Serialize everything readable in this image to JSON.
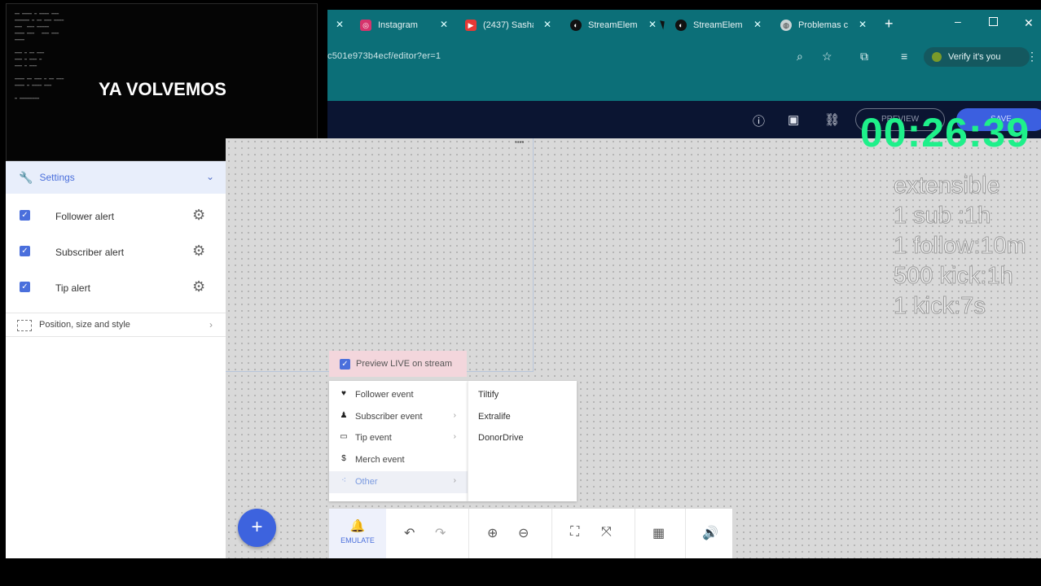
{
  "browser": {
    "tabs": [
      {
        "label": "Instagram",
        "icon": "instagram-icon"
      },
      {
        "label": "(2437) Sasha",
        "icon": "youtube-icon"
      },
      {
        "label": "StreamElem",
        "icon": "streamelements-icon"
      },
      {
        "label": "StreamElem",
        "icon": "streamelements-icon"
      },
      {
        "label": "Problemas c",
        "icon": "globe-icon"
      }
    ],
    "url": "c501e973b4ecf/editor?er=1",
    "verify_label": "Verify it's you",
    "accent_color": "#0c6f78"
  },
  "scene": {
    "title": "YA VOLVEMOS"
  },
  "editor": {
    "preview_label": "PREVIEW",
    "save_label": "SAVE"
  },
  "overlay": {
    "timer": "00:26:39",
    "lines": [
      "extensible",
      "1 sub :1h",
      "1 follow:10m",
      "500 kick:1h",
      "1 kick:7s"
    ]
  },
  "settings": {
    "title": "Settings",
    "alerts": [
      {
        "label": "Follower alert",
        "checked": true
      },
      {
        "label": "Subscriber alert",
        "checked": true
      },
      {
        "label": "Tip alert",
        "checked": true
      }
    ],
    "position_label": "Position, size and style"
  },
  "preview_live": {
    "label": "Preview LIVE on stream",
    "checked": true
  },
  "emulate_menu": {
    "items": [
      {
        "label": "Follower event",
        "icon": "heart-icon",
        "has_sub": false
      },
      {
        "label": "Subscriber event",
        "icon": "user-plus-icon",
        "has_sub": true
      },
      {
        "label": "Tip event",
        "icon": "card-icon",
        "has_sub": true
      },
      {
        "label": "Merch event",
        "icon": "dollar-icon",
        "has_sub": false
      },
      {
        "label": "Other",
        "icon": "dots-icon",
        "has_sub": true,
        "active": true
      }
    ],
    "submenu": [
      "Tiltify",
      "Extralife",
      "DonorDrive"
    ]
  },
  "toolbar": {
    "emulate_label": "EMULATE",
    "add_label": "+"
  }
}
